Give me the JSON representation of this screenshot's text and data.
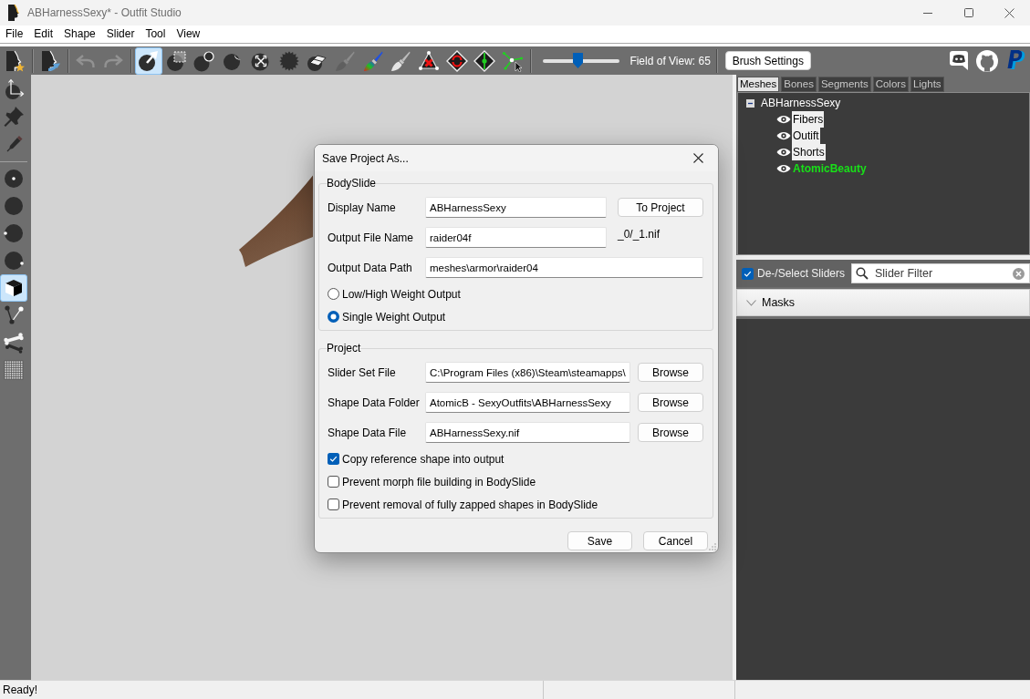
{
  "window": {
    "title": "ABHarnessSexy* - Outfit Studio"
  },
  "menu": [
    "File",
    "Edit",
    "Shape",
    "Slider",
    "Tool",
    "View"
  ],
  "toolbar": {
    "groups": [
      [
        {
          "kind": "new",
          "selected": false,
          "disabled": false
        }
      ],
      [
        {
          "kind": "reference",
          "selected": false,
          "disabled": false
        }
      ],
      [
        {
          "kind": "undo",
          "selected": false,
          "disabled": true
        },
        {
          "kind": "redo",
          "selected": false,
          "disabled": true
        }
      ],
      [
        {
          "kind": "select",
          "selected": true,
          "disabled": false
        },
        {
          "kind": "mask",
          "selected": false,
          "disabled": false
        },
        {
          "kind": "inflate",
          "selected": false,
          "disabled": false
        },
        {
          "kind": "deflate",
          "selected": false,
          "disabled": false
        },
        {
          "kind": "move",
          "selected": false,
          "disabled": false
        },
        {
          "kind": "smooth",
          "selected": false,
          "disabled": false
        },
        {
          "kind": "undiff",
          "selected": false,
          "disabled": false
        },
        {
          "kind": "weight",
          "selected": false,
          "disabled": true
        },
        {
          "kind": "color",
          "selected": false,
          "disabled": false
        },
        {
          "kind": "alpha",
          "selected": false,
          "disabled": false
        },
        {
          "kind": "collapse",
          "selected": false,
          "disabled": false
        },
        {
          "kind": "flip",
          "selected": false,
          "disabled": false
        },
        {
          "kind": "split",
          "selected": false,
          "disabled": false
        },
        {
          "kind": "vertices",
          "selected": false,
          "disabled": false
        }
      ]
    ],
    "fov": {
      "level": 0.45,
      "label": "Field of View: 65"
    },
    "brush_settings": "Brush Settings",
    "links": [
      {
        "kind": "discord"
      },
      {
        "kind": "github"
      },
      {
        "kind": "paypal"
      }
    ]
  },
  "side_toolbar": {
    "groups": [
      [
        {
          "kind": "axes",
          "selected": false
        },
        {
          "kind": "pin",
          "selected": false
        },
        {
          "kind": "pencil",
          "selected": false
        }
      ],
      [
        {
          "kind": "center",
          "selected": false
        },
        {
          "kind": "plain",
          "selected": false
        },
        {
          "kind": "left",
          "selected": false
        },
        {
          "kind": "right",
          "selected": false
        },
        {
          "kind": "cube",
          "selected": true
        },
        {
          "kind": "nodes",
          "selected": false
        },
        {
          "kind": "bone",
          "selected": false
        },
        {
          "kind": "grid",
          "selected": false
        }
      ]
    ]
  },
  "panel": {
    "tabs": [
      {
        "label": "Meshes",
        "selected": true
      },
      {
        "label": "Bones",
        "selected": false
      },
      {
        "label": "Segments",
        "selected": false
      },
      {
        "label": "Colors",
        "selected": false
      },
      {
        "label": "Lights",
        "selected": false
      }
    ],
    "tree": {
      "label": "ABHarnessSexy",
      "expanded": true,
      "children": [
        {
          "label": "Fibers",
          "visible": true,
          "selected": true,
          "reference": false
        },
        {
          "label": "Outift",
          "visible": true,
          "selected": true,
          "reference": false
        },
        {
          "label": "Shorts",
          "visible": true,
          "selected": true,
          "reference": false
        },
        {
          "label": "AtomicBeauty",
          "visible": true,
          "selected": false,
          "reference": true
        }
      ]
    },
    "slider_toggle": {
      "label": "De-/Select Sliders",
      "checked": true
    },
    "slider_filter": {
      "placeholder": "Slider Filter"
    },
    "masks": {
      "label": "Masks"
    }
  },
  "dialog": {
    "title": "Save Project As...",
    "groups": [
      {
        "title": "BodySlide",
        "rows": [
          {
            "kind": "field",
            "label": "Display Name",
            "value": "ABHarnessSexy",
            "button": "To Project"
          },
          {
            "kind": "field",
            "label": "Output File Name",
            "value": "raider04f",
            "suffix": "_0/_1.nif"
          },
          {
            "kind": "field",
            "label": "Output Data Path",
            "value": "meshes\\armor\\raider04"
          },
          {
            "kind": "radio",
            "label": "Low/High Weight Output",
            "selected": false
          },
          {
            "kind": "radio",
            "label": "Single Weight Output",
            "selected": true
          }
        ]
      },
      {
        "title": "Project",
        "rows": [
          {
            "kind": "field",
            "label": "Slider Set File",
            "value": "C:\\Program Files (x86)\\Steam\\steamapps\\",
            "button": "Browse"
          },
          {
            "kind": "field",
            "label": "Shape Data Folder",
            "value": "AtomicB - SexyOutfits\\ABHarnessSexy",
            "button": "Browse"
          },
          {
            "kind": "field",
            "label": "Shape Data File",
            "value": "ABHarnessSexy.nif",
            "button": "Browse"
          },
          {
            "kind": "checkbox",
            "label": "Copy reference shape into output",
            "checked": true
          },
          {
            "kind": "checkbox",
            "label": "Prevent morph file building in BodySlide",
            "checked": false
          },
          {
            "kind": "checkbox",
            "label": "Prevent removal of fully zapped shapes in BodySlide",
            "checked": false
          }
        ]
      }
    ],
    "buttons": [
      "Save",
      "Cancel"
    ]
  },
  "status_bar": {
    "text": "Ready!"
  }
}
